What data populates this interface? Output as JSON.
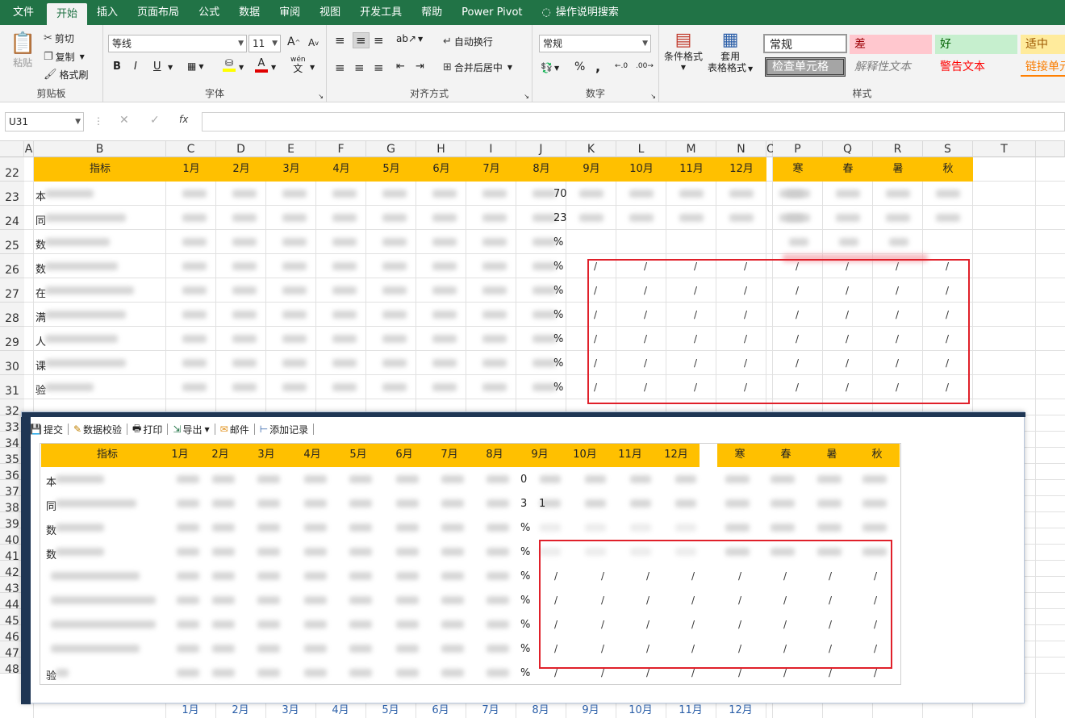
{
  "tabs": [
    "文件",
    "开始",
    "插入",
    "页面布局",
    "公式",
    "数据",
    "审阅",
    "视图",
    "开发工具",
    "帮助",
    "Power Pivot",
    "操作说明搜索"
  ],
  "active_tab": "开始",
  "clipboard": {
    "paste": "粘贴",
    "cut": "剪切",
    "copy": "复制",
    "format_painter": "格式刷",
    "label": "剪贴板"
  },
  "font": {
    "name": "等线",
    "size": "11",
    "label": "字体",
    "bold": "B",
    "italic": "I",
    "underline": "U",
    "grow": "A",
    "shrink": "A",
    "font_color_glyph": "A",
    "phonetic": "wén",
    "phonetic2": "文"
  },
  "alignment": {
    "wrap": "自动换行",
    "merge": "合并后居中",
    "label": "对齐方式"
  },
  "number": {
    "format": "常规",
    "percent": "%",
    "comma": ",",
    "label": "数字"
  },
  "styles": {
    "cond_format": "条件格式",
    "table_format_1": "套用",
    "table_format_2": "表格格式",
    "label": "样式",
    "cells": [
      "常规",
      "差",
      "好",
      "适中",
      "检查单元格",
      "解释性文本",
      "警告文本",
      "链接单元"
    ]
  },
  "name_box": "U31",
  "fx": "fx",
  "columns": [
    "A",
    "B",
    "C",
    "D",
    "E",
    "F",
    "G",
    "H",
    "I",
    "J",
    "K",
    "L",
    "M",
    "N",
    "O",
    "P",
    "Q",
    "R",
    "S",
    "T"
  ],
  "rows": [
    "22",
    "23",
    "24",
    "25",
    "26",
    "27",
    "28",
    "29",
    "30",
    "31",
    "32",
    "33",
    "34",
    "35",
    "36",
    "37",
    "38",
    "39",
    "40",
    "41",
    "42",
    "43",
    "44",
    "45",
    "46",
    "47",
    "48"
  ],
  "table_header": {
    "indicator": "指标",
    "months": [
      "1月",
      "2月",
      "3月",
      "4月",
      "5月",
      "6月",
      "7月",
      "8月",
      "9月",
      "10月",
      "11月",
      "12月"
    ],
    "seasons": [
      "寒",
      "春",
      "暑",
      "秋"
    ]
  },
  "j_values": [
    "70",
    "23",
    "%",
    "%",
    "%",
    "%",
    "%",
    "%",
    "%"
  ],
  "row_first_chars": [
    "本",
    "同",
    "数",
    "数",
    "在",
    "满",
    "人",
    "课",
    "验"
  ],
  "slash": "/",
  "dialog": {
    "toolbar": [
      "提交",
      "数据校验",
      "打印",
      "导出",
      "邮件",
      "添加记录"
    ],
    "j_values": [
      "0",
      "3",
      "%",
      "%",
      "%",
      "%",
      "%",
      "%",
      "%"
    ],
    "row_first_chars": [
      "本",
      "同",
      "数",
      "数",
      "",
      "",
      "",
      "",
      "验"
    ],
    "extra_one": "1"
  },
  "bottom_months": [
    "1月",
    "2月",
    "3月",
    "4月",
    "5月",
    "6月",
    "7月",
    "8月",
    "9月",
    "10月",
    "11月",
    "12月"
  ],
  "colors": {
    "accent": "#217346",
    "header_fill": "#ffc000",
    "highlight": "#e0202a",
    "dialog_frame": "#1f3654"
  }
}
